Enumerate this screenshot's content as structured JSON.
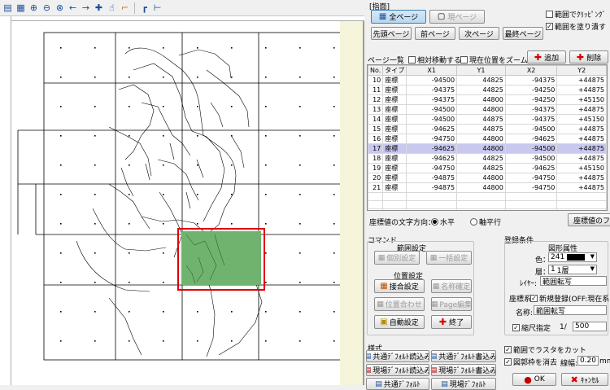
{
  "toolbar": {
    "icons": [
      "open-icon",
      "layers-icon",
      "zoom-in-icon",
      "zoom-out-icon",
      "zoom-fit-icon",
      "arrow-left-icon",
      "arrow-right-icon",
      "plus-icon",
      "hand-pan-icon",
      "corner-icon",
      "ruler-icon",
      "measure-icon"
    ]
  },
  "panel": {
    "section_label": "[指面]",
    "all_pages": "全ページ",
    "current_page": "現ページ",
    "range_clip": "範囲でｸﾘｯﾋﾟﾝｸﾞ",
    "range_clip_checked": false,
    "range_fill": "範囲を塗り潰す",
    "range_fill_checked": true,
    "first_page": "先頭ページ",
    "prev_page": "前ページ",
    "next_page": "次ページ",
    "last_page": "最終ページ"
  },
  "page_list": {
    "label": "ページ一覧",
    "relative_move": "相対移動する",
    "relative_move_checked": false,
    "zoom_current": "現在位置をズーム",
    "zoom_current_checked": false,
    "add_button": "追加",
    "delete_button": "削除",
    "columns": [
      "No.",
      "タイプ",
      "X1",
      "Y1",
      "X2",
      "Y2"
    ],
    "rows": [
      {
        "no": "10",
        "type": "座標",
        "x1": "-94500",
        "y1": "44825",
        "x2": "-94375",
        "y2": "+44875"
      },
      {
        "no": "11",
        "type": "座標",
        "x1": "-94375",
        "y1": "44825",
        "x2": "-94250",
        "y2": "+44875"
      },
      {
        "no": "12",
        "type": "座標",
        "x1": "-94375",
        "y1": "44800",
        "x2": "-94250",
        "y2": "+45150"
      },
      {
        "no": "13",
        "type": "座標",
        "x1": "-94500",
        "y1": "44800",
        "x2": "-94375",
        "y2": "+44875"
      },
      {
        "no": "14",
        "type": "座標",
        "x1": "-94500",
        "y1": "44875",
        "x2": "-94375",
        "y2": "+45150"
      },
      {
        "no": "15",
        "type": "座標",
        "x1": "-94625",
        "y1": "44875",
        "x2": "-94500",
        "y2": "+44875"
      },
      {
        "no": "16",
        "type": "座標",
        "x1": "-94750",
        "y1": "44800",
        "x2": "-94625",
        "y2": "+44875"
      },
      {
        "no": "17",
        "type": "座標",
        "x1": "-94625",
        "y1": "44800",
        "x2": "-94500",
        "y2": "+44875"
      },
      {
        "no": "18",
        "type": "座標",
        "x1": "-94625",
        "y1": "44825",
        "x2": "-94500",
        "y2": "+44875"
      },
      {
        "no": "19",
        "type": "座標",
        "x1": "-94750",
        "y1": "44825",
        "x2": "-94625",
        "y2": "+45150"
      },
      {
        "no": "20",
        "type": "座標",
        "x1": "-94875",
        "y1": "44800",
        "x2": "-94750",
        "y2": "+44875"
      },
      {
        "no": "21",
        "type": "座標",
        "x1": "-94875",
        "y1": "44800",
        "x2": "-94750",
        "y2": "+44875"
      }
    ],
    "selected_row": "17"
  },
  "coord_text": {
    "label": "座標値の文字方向：",
    "horizontal": "水平",
    "axis_parallel": "軸平行",
    "selected": "水平",
    "coord_button": "座標値のフ"
  },
  "command": {
    "label": "コマンド",
    "range_label": "範囲設定",
    "individual": "個別設定",
    "batch": "一括設定",
    "position_label": "位置設定",
    "grid_button": "接合設定",
    "name_input": "名称確定",
    "align_button": "位置合わせ",
    "page_edit": "Page編集",
    "auto_button": "自動設定",
    "end_button": "終了"
  },
  "register": {
    "label": "登録条件",
    "shape_attr_label": "図形属性",
    "color_label": "色：",
    "color_value": "241",
    "color_hex": "#000000",
    "layer_label": "層：",
    "layer_value": "1",
    "layer_unit": "1層",
    "layer_name_label": "ﾚｲﾔｰ:",
    "layer_name_value": "範囲転写",
    "coord_label": "座標系",
    "new_register": "新規登録(OFF:現在系)",
    "new_register_checked": true,
    "name_label": "名称:",
    "name_value": "範囲転写",
    "scale_label": "縮尺指定",
    "scale_checked": true,
    "scale_prefix": "1/",
    "scale_value": "500"
  },
  "style": {
    "label": "様式",
    "common_set": "共通ﾃﾞﾌｫﾙﾄ読込み",
    "common_save": "共通ﾃﾞﾌｫﾙﾄ書込み",
    "user_set": "現場ﾃﾞﾌｫﾙﾄ読込み",
    "user_save": "現場ﾃﾞﾌｫﾙﾄ書込み",
    "more_1": "共通ﾃﾞﾌｫﾙﾄ",
    "more_2": "現場ﾃﾞﾌｫﾙﾄ"
  },
  "options": {
    "raster_cut": "範囲でラスタをカット",
    "raster_cut_checked": true,
    "outline_clear": "図郭枠を消去",
    "outline_clear_checked": true,
    "line_width_label": "線幅:",
    "line_width_value": "0.20",
    "line_width_unit": "mm",
    "ok_button": "OK",
    "cancel_button": "ｷｬﾝｾﾙ"
  },
  "colors": {
    "selection_red": "#e00000",
    "fill_green": "#6fb36f",
    "row_highlight": "#c9c8ee"
  }
}
